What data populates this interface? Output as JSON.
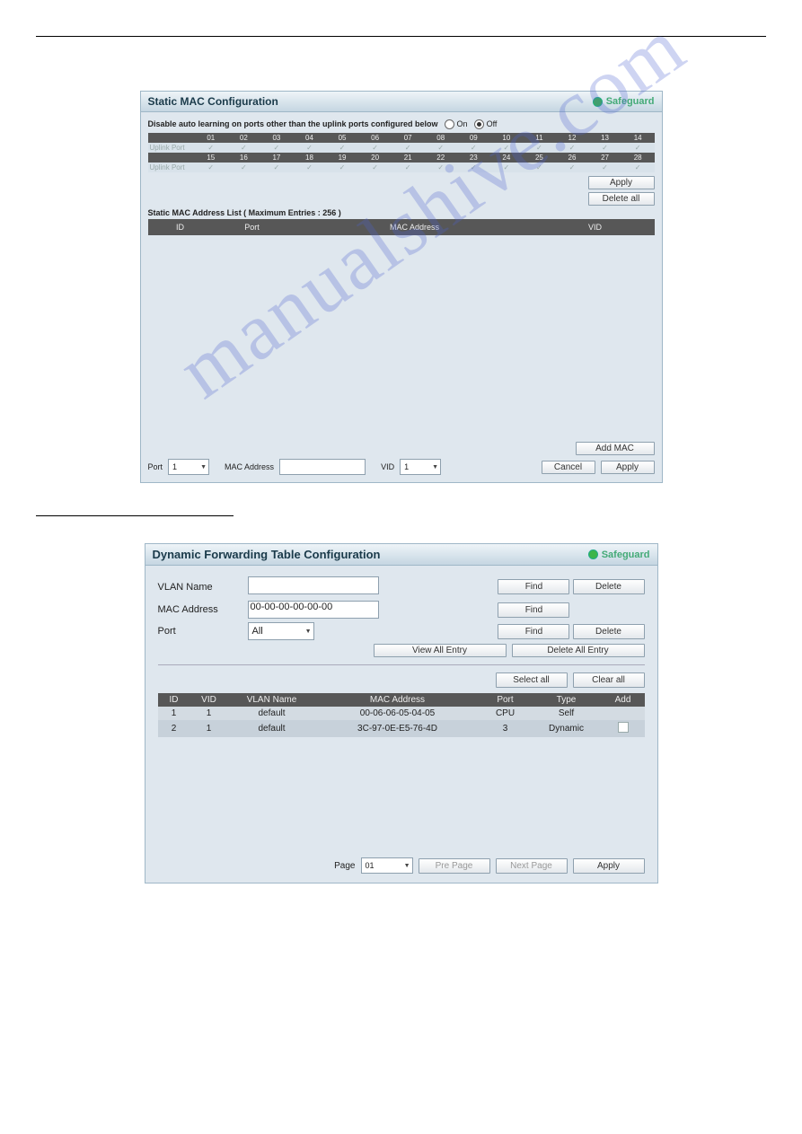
{
  "watermark": "manualshive.com",
  "panel1": {
    "title": "Static MAC Configuration",
    "safeguard": "Safeguard",
    "disable_label": "Disable auto learning on ports other than the uplink ports configured below",
    "radio_on": "On",
    "radio_off": "Off",
    "uplink_label": "Uplink Port",
    "row1": [
      "01",
      "02",
      "03",
      "04",
      "05",
      "06",
      "07",
      "08",
      "09",
      "10",
      "11",
      "12",
      "13",
      "14"
    ],
    "row2": [
      "15",
      "16",
      "17",
      "18",
      "19",
      "20",
      "21",
      "22",
      "23",
      "24",
      "25",
      "26",
      "27",
      "28"
    ],
    "apply_btn": "Apply",
    "delete_all_btn": "Delete all",
    "entries_label": "Static MAC Address List ( Maximum Entries : 256 )",
    "list_cols": {
      "id": "ID",
      "port": "Port",
      "mac": "MAC Address",
      "vid": "VID"
    },
    "add_mac_btn": "Add MAC",
    "footer": {
      "port_label": "Port",
      "port_value": "1",
      "mac_label": "MAC Address",
      "vid_label": "VID",
      "vid_value": "1",
      "cancel_btn": "Cancel",
      "apply_btn": "Apply"
    }
  },
  "panel2": {
    "title": "Dynamic Forwarding Table Configuration",
    "safeguard": "Safeguard",
    "vlan_name_label": "VLAN Name",
    "mac_label": "MAC Address",
    "mac_value": "00-00-00-00-00-00",
    "port_label": "Port",
    "port_value": "All",
    "find_btn": "Find",
    "delete_btn": "Delete",
    "view_all_btn": "View All Entry",
    "delete_all_btn": "Delete All Entry",
    "select_all_btn": "Select all",
    "clear_all_btn": "Clear all",
    "cols": {
      "id": "ID",
      "vid": "VID",
      "vlan": "VLAN Name",
      "mac": "MAC Address",
      "port": "Port",
      "type": "Type",
      "add": "Add"
    },
    "rows": [
      {
        "id": "1",
        "vid": "1",
        "vlan": "default",
        "mac": "00-06-06-05-04-05",
        "port": "CPU",
        "type": "Self",
        "add": ""
      },
      {
        "id": "2",
        "vid": "1",
        "vlan": "default",
        "mac": "3C-97-0E-E5-76-4D",
        "port": "3",
        "type": "Dynamic",
        "add": "chk"
      }
    ],
    "footer": {
      "page_label": "Page",
      "page_value": "01",
      "prev_btn": "Pre Page",
      "next_btn": "Next Page",
      "apply_btn": "Apply"
    }
  }
}
